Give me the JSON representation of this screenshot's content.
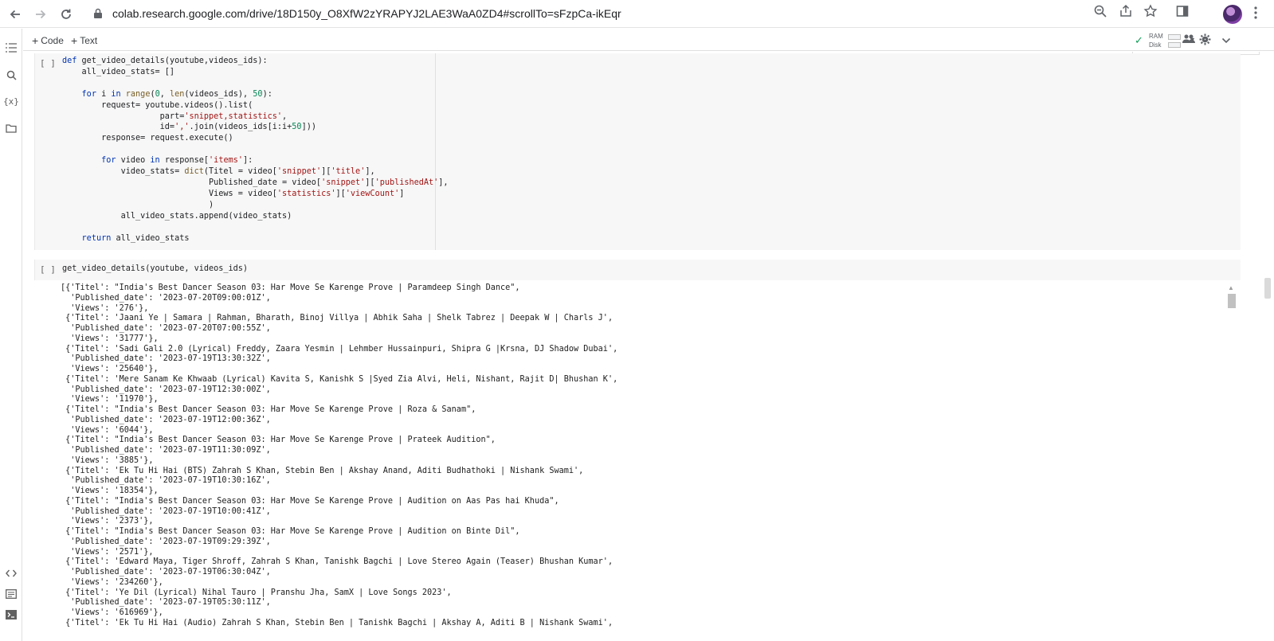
{
  "browser": {
    "url": "colab.research.google.com/drive/18D150y_O8XfW2zYRAPYJ2LAE3WaA0ZD4#scrollTo=sFzpCa-ikEqr"
  },
  "toolbar": {
    "add_code_label": "Code",
    "add_text_label": "Text",
    "ram_label": "RAM",
    "disk_label": "Disk"
  },
  "cells": [
    {
      "run_marker": "[ ]",
      "code_lines": [
        "def get_video_details(youtube,videos_ids):",
        "    all_video_stats= []",
        "",
        "    for i in range(0, len(videos_ids), 50):",
        "        request= youtube.videos().list(",
        "                    part='snippet,statistics',",
        "                    id=','.join(videos_ids[i:i+50]))",
        "        response= request.execute()",
        "",
        "        for video in response['items']:",
        "            video_stats= dict(Titel = video['snippet']['title'],",
        "                              Published_date = video['snippet']['publishedAt'],",
        "                              Views = video['statistics']['viewCount']",
        "                              )",
        "            all_video_stats.append(video_stats)",
        "",
        "    return all_video_stats"
      ]
    },
    {
      "run_marker": "[ ]",
      "code_lines": [
        "get_video_details(youtube, videos_ids)"
      ]
    }
  ],
  "output_lines": [
    "[{'Titel': \"India's Best Dancer Season 03: Har Move Se Karenge Prove | Paramdeep Singh Dance\",",
    "  'Published_date': '2023-07-20T09:00:01Z',",
    "  'Views': '276'},",
    " {'Titel': 'Jaani Ye | Samara | Rahman, Bharath, Binoj Villya | Abhik Saha | Shelk Tabrez | Deepak W | Charls J',",
    "  'Published_date': '2023-07-20T07:00:55Z',",
    "  'Views': '31777'},",
    " {'Titel': 'Sadi Gali 2.0 (Lyrical) Freddy, Zaara Yesmin | Lehmber Hussainpuri, Shipra G |Krsna, DJ Shadow Dubai',",
    "  'Published_date': '2023-07-19T13:30:32Z',",
    "  'Views': '25640'},",
    " {'Titel': 'Mere Sanam Ke Khwaab (Lyrical) Kavita S, Kanishk S |Syed Zia Alvi, Heli, Nishant, Rajit D| Bhushan K',",
    "  'Published_date': '2023-07-19T12:30:00Z',",
    "  'Views': '11970'},",
    " {'Titel': \"India's Best Dancer Season 03: Har Move Se Karenge Prove | Roza & Sanam\",",
    "  'Published_date': '2023-07-19T12:00:36Z',",
    "  'Views': '6044'},",
    " {'Titel': \"India's Best Dancer Season 03: Har Move Se Karenge Prove | Prateek Audition\",",
    "  'Published_date': '2023-07-19T11:30:09Z',",
    "  'Views': '3885'},",
    " {'Titel': 'Ek Tu Hi Hai (BTS) Zahrah S Khan, Stebin Ben | Akshay Anand, Aditi Budhathoki | Nishank Swami',",
    "  'Published_date': '2023-07-19T10:30:16Z',",
    "  'Views': '18354'},",
    " {'Titel': \"India's Best Dancer Season 03: Har Move Se Karenge Prove | Audition on Aas Pas hai Khuda\",",
    "  'Published_date': '2023-07-19T10:00:41Z',",
    "  'Views': '2373'},",
    " {'Titel': \"India's Best Dancer Season 03: Har Move Se Karenge Prove | Audition on Binte Dil\",",
    "  'Published_date': '2023-07-19T09:29:39Z',",
    "  'Views': '2571'},",
    " {'Titel': 'Edward Maya, Tiger Shroff, Zahrah S Khan, Tanishk Bagchi | Love Stereo Again (Teaser) Bhushan Kumar',",
    "  'Published_date': '2023-07-19T06:30:04Z',",
    "  'Views': '234260'},",
    " {'Titel': 'Ye Dil (Lyrical) Nihal Tauro | Pranshu Jha, SamX | Love Songs 2023',",
    "  'Published_date': '2023-07-19T05:30:11Z',",
    "  'Views': '616969'},",
    " {'Titel': 'Ek Tu Hi Hai (Audio) Zahrah S Khan, Stebin Ben | Tanishk Bagchi | Akshay A, Aditi B | Nishank Swami',"
  ],
  "icons": {
    "back": "back-arrow-icon",
    "forward": "forward-arrow-icon",
    "reload": "reload-icon",
    "lock": "lock-icon",
    "zoom": "zoom-icon",
    "share": "share-icon",
    "bookmark": "star-icon",
    "sidepanel": "side-panel-icon",
    "menu": "more-vert-icon"
  },
  "colors": {
    "keyword": "#0033b3",
    "string": "#a31515",
    "number": "#098658",
    "function": "#795e26",
    "connected": "#0f9d58"
  }
}
